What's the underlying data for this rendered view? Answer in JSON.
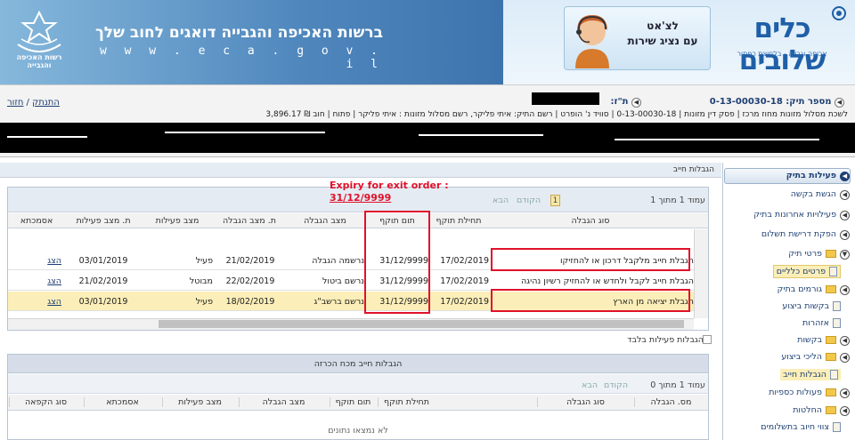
{
  "header": {
    "banner_title": "ברשות האכיפה והגבייה דואגים לחוב שלך",
    "banner_url": "w w w . e c a . g o v . i l",
    "authority_logo_text": "רשות האכיפה והגבייה",
    "chat_line1": "לצ'אט",
    "chat_line2": "עם נציג שירות",
    "brand_name": "כלים שלובים",
    "brand_sub": "אכיפה וגבייה - בלחיצת כפתור"
  },
  "infobar": {
    "case_label": "מספר תיק: 0-13-00030-18",
    "id_label": "ת\"ז:",
    "back_link": "חזור",
    "logout_link": "התנתק",
    "detail_line": "לשכת מסלול מזונות מחוז מרכז | פסק דין מזונות | 0-13-00030-18 | סוויד נ' הופרט | רשם התיק: איתי פליקר, רשם מסלול מזונות : איתי פליקר | פתוח | חוב ₪ 3,896.17"
  },
  "main": {
    "title": "הגבלות חייב",
    "annotation_title": "Expiry for exit order :",
    "annotation_value": "31/12/9999",
    "pager": {
      "page_of": "עמוד 1 מתוך 1",
      "prev": "הקודם",
      "next": "הבא",
      "current": "1"
    },
    "columns": [
      "סוג הגבלה",
      "תחילת תוקף",
      "תום תוקף",
      "מצב הגבלה",
      "ת. מצב הגבלה",
      "מצב פעילות",
      "ת. מצב פעילות",
      "אסמכתא"
    ],
    "rows": [
      {
        "type": "הגבלת חייב מלקבל דרכון או להחזיקו",
        "start": "17/02/2019",
        "end": "31/12/9999",
        "status": "נרשמה הגבלה",
        "status_date": "21/02/2019",
        "activity": "פעיל",
        "activity_date": "03/01/2019",
        "ref": "הצג"
      },
      {
        "type": "הגבלת חייב לקבל ולחדש או להחזיק רשיון נהיגה",
        "start": "17/02/2019",
        "end": "31/12/9999",
        "status": "נרשם ביטול",
        "status_date": "22/02/2019",
        "activity": "מבוטל",
        "activity_date": "21/02/2019",
        "ref": "הצג"
      },
      {
        "type": "הגבלת יציאה מן הארץ",
        "start": "17/02/2019",
        "end": "31/12/9999",
        "status": "נרשם ברשב\"ג",
        "status_date": "18/02/2019",
        "activity": "פעיל",
        "activity_date": "03/01/2019",
        "ref": "הצג"
      }
    ],
    "only_active_label": "הגבלות פעילות בלבד"
  },
  "pane2": {
    "title": "הגבלות חייב מכח הכרזה",
    "pager": {
      "page_of": "עמוד 1 מתוך 0",
      "prev": "הקודם",
      "next": "הבא"
    },
    "columns": [
      "מס. הגבלה",
      "סוג הגבלה",
      "תחילת תוקף",
      "תום תוקף",
      "מצב הגבלה",
      "מצב פעילות",
      "אסמכתא",
      "סוג הקפאה"
    ],
    "no_data": "לא נמצאו נתונים"
  },
  "sidebar": {
    "header": "פעילות בתיק",
    "items": [
      "הגשת בקשה",
      "פעילויות אחרונות בתיק",
      "הפקת דרישת תשלום",
      "פרטי תיק",
      "פרטים כלליים",
      "גורמים בתיק",
      "בקשות ביצוע",
      "אזהרות",
      "בקשות",
      "הליכי ביצוע",
      "הגבלות חייב",
      "פעולות כספיות",
      "החלטות",
      "צווי חיוב בתשלומים"
    ]
  },
  "colors": {
    "accent": "#e0112a",
    "link": "#1d3f73",
    "highlight_row": "#fbeeb8",
    "sidebar_selected": "#fbeeb8"
  }
}
